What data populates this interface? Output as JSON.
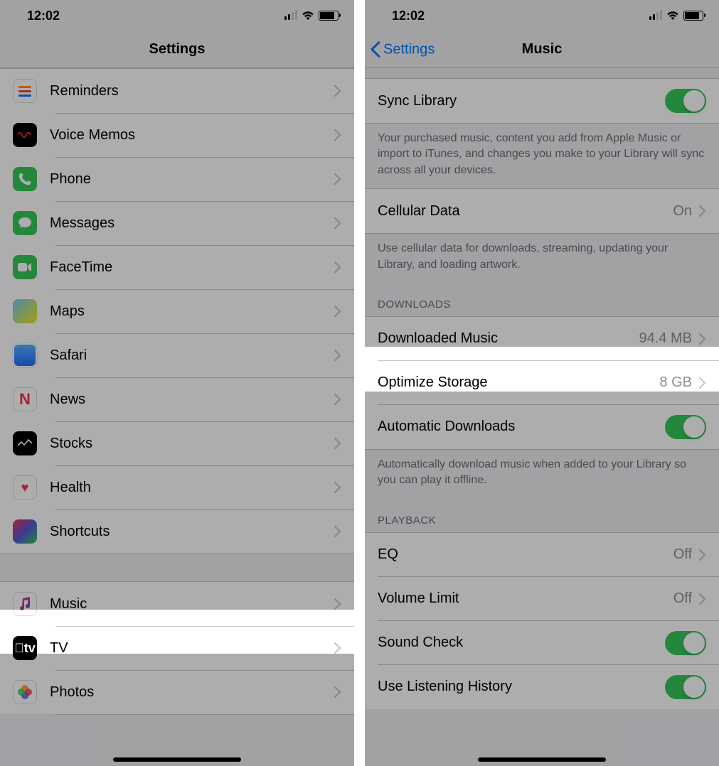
{
  "left": {
    "time": "12:02",
    "title": "Settings",
    "rows1": [
      {
        "label": "Reminders"
      },
      {
        "label": "Voice Memos"
      },
      {
        "label": "Phone"
      },
      {
        "label": "Messages"
      },
      {
        "label": "FaceTime"
      },
      {
        "label": "Maps"
      },
      {
        "label": "Safari"
      },
      {
        "label": "News"
      },
      {
        "label": "Stocks"
      },
      {
        "label": "Health"
      },
      {
        "label": "Shortcuts"
      }
    ],
    "rows2": [
      {
        "label": "Music"
      },
      {
        "label": "TV"
      },
      {
        "label": "Photos"
      }
    ]
  },
  "right": {
    "time": "12:02",
    "back": "Settings",
    "title": "Music",
    "sync": {
      "label": "Sync Library"
    },
    "sync_footer": "Your purchased music, content you add from Apple Music or import to iTunes, and changes you make to your Library will sync across all your devices.",
    "cellular": {
      "label": "Cellular Data",
      "value": "On"
    },
    "cellular_footer": "Use cellular data for downloads, streaming, updating your Library, and loading artwork.",
    "downloads_header": "DOWNLOADS",
    "downloaded": {
      "label": "Downloaded Music",
      "value": "94.4 MB"
    },
    "optimize": {
      "label": "Optimize Storage",
      "value": "8 GB"
    },
    "autodl": {
      "label": "Automatic Downloads"
    },
    "autodl_footer": "Automatically download music when added to your Library so you can play it offline.",
    "playback_header": "PLAYBACK",
    "eq": {
      "label": "EQ",
      "value": "Off"
    },
    "volume": {
      "label": "Volume Limit",
      "value": "Off"
    },
    "sound": {
      "label": "Sound Check"
    },
    "history": {
      "label": "Use Listening History"
    }
  }
}
